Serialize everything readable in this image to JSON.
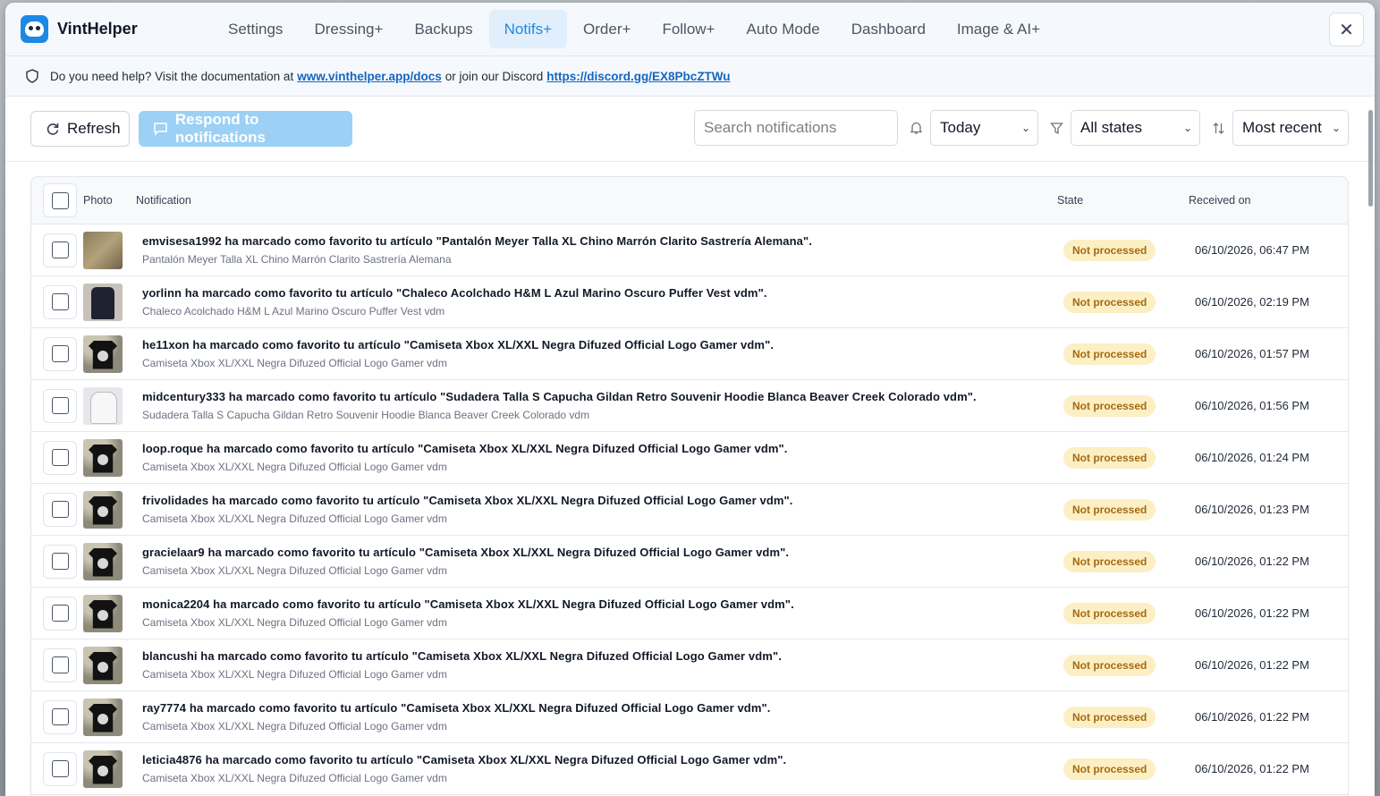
{
  "app": {
    "name": "VintHelper"
  },
  "nav": {
    "items": [
      {
        "label": "Settings",
        "active": false
      },
      {
        "label": "Dressing+",
        "active": false
      },
      {
        "label": "Backups",
        "active": false
      },
      {
        "label": "Notifs+",
        "active": true
      },
      {
        "label": "Order+",
        "active": false
      },
      {
        "label": "Follow+",
        "active": false
      },
      {
        "label": "Auto Mode",
        "active": false
      },
      {
        "label": "Dashboard",
        "active": false
      },
      {
        "label": "Image & AI+",
        "active": false
      }
    ],
    "close_symbol": "✕"
  },
  "help": {
    "prefix": "Do you need help? Visit the documentation at",
    "docs_link": "www.vinthelper.app/docs",
    "middle": "or join our Discord",
    "discord_link": "https://discord.gg/EX8PbcZTWu"
  },
  "toolbar": {
    "refresh_label": "Refresh",
    "respond_label": "Respond to notifications",
    "search_placeholder": "Search notifications",
    "date_filter": "Today",
    "state_filter": "All states",
    "sort": "Most recent"
  },
  "table": {
    "headers": {
      "photo": "Photo",
      "notification": "Notification",
      "state": "State",
      "received": "Received on"
    },
    "rows": [
      {
        "thumb": "pants",
        "main": "emvisesa1992 ha marcado como favorito tu artículo \"Pantalón Meyer Talla XL Chino Marrón Clarito Sastrería Alemana\".",
        "sub": "Pantalón Meyer Talla XL Chino Marrón Clarito Sastrería Alemana",
        "state": "Not processed",
        "received": "06/10/2026, 06:47 PM"
      },
      {
        "thumb": "vest",
        "main": "yorlinn ha marcado como favorito tu artículo \"Chaleco Acolchado H&M L Azul Marino Oscuro Puffer Vest vdm\".",
        "sub": "Chaleco Acolchado H&M L Azul Marino Oscuro Puffer Vest vdm",
        "state": "Not processed",
        "received": "06/10/2026, 02:19 PM"
      },
      {
        "thumb": "tee",
        "main": "he11xon ha marcado como favorito tu artículo \"Camiseta Xbox XL/XXL Negra Difuzed Official Logo Gamer vdm\".",
        "sub": "Camiseta Xbox XL/XXL Negra Difuzed Official Logo Gamer vdm",
        "state": "Not processed",
        "received": "06/10/2026, 01:57 PM"
      },
      {
        "thumb": "hoodie",
        "main": "midcentury333 ha marcado como favorito tu artículo \"Sudadera Talla S Capucha Gildan Retro Souvenir Hoodie Blanca Beaver Creek Colorado vdm\".",
        "sub": "Sudadera Talla S Capucha Gildan Retro Souvenir Hoodie Blanca Beaver Creek Colorado vdm",
        "state": "Not processed",
        "received": "06/10/2026, 01:56 PM"
      },
      {
        "thumb": "tee",
        "main": "loop.roque ha marcado como favorito tu artículo \"Camiseta Xbox XL/XXL Negra Difuzed Official Logo Gamer vdm\".",
        "sub": "Camiseta Xbox XL/XXL Negra Difuzed Official Logo Gamer vdm",
        "state": "Not processed",
        "received": "06/10/2026, 01:24 PM"
      },
      {
        "thumb": "tee",
        "main": "frivolidades ha marcado como favorito tu artículo \"Camiseta Xbox XL/XXL Negra Difuzed Official Logo Gamer vdm\".",
        "sub": "Camiseta Xbox XL/XXL Negra Difuzed Official Logo Gamer vdm",
        "state": "Not processed",
        "received": "06/10/2026, 01:23 PM"
      },
      {
        "thumb": "tee",
        "main": "gracielaar9 ha marcado como favorito tu artículo \"Camiseta Xbox XL/XXL Negra Difuzed Official Logo Gamer vdm\".",
        "sub": "Camiseta Xbox XL/XXL Negra Difuzed Official Logo Gamer vdm",
        "state": "Not processed",
        "received": "06/10/2026, 01:22 PM"
      },
      {
        "thumb": "tee",
        "main": "monica2204 ha marcado como favorito tu artículo \"Camiseta Xbox XL/XXL Negra Difuzed Official Logo Gamer vdm\".",
        "sub": "Camiseta Xbox XL/XXL Negra Difuzed Official Logo Gamer vdm",
        "state": "Not processed",
        "received": "06/10/2026, 01:22 PM"
      },
      {
        "thumb": "tee",
        "main": "blancushi ha marcado como favorito tu artículo \"Camiseta Xbox XL/XXL Negra Difuzed Official Logo Gamer vdm\".",
        "sub": "Camiseta Xbox XL/XXL Negra Difuzed Official Logo Gamer vdm",
        "state": "Not processed",
        "received": "06/10/2026, 01:22 PM"
      },
      {
        "thumb": "tee",
        "main": "ray7774 ha marcado como favorito tu artículo \"Camiseta Xbox XL/XXL Negra Difuzed Official Logo Gamer vdm\".",
        "sub": "Camiseta Xbox XL/XXL Negra Difuzed Official Logo Gamer vdm",
        "state": "Not processed",
        "received": "06/10/2026, 01:22 PM"
      },
      {
        "thumb": "tee",
        "main": "leticia4876 ha marcado como favorito tu artículo \"Camiseta Xbox XL/XXL Negra Difuzed Official Logo Gamer vdm\".",
        "sub": "Camiseta Xbox XL/XXL Negra Difuzed Official Logo Gamer vdm",
        "state": "Not processed",
        "received": "06/10/2026, 01:22 PM"
      }
    ]
  },
  "colors": {
    "accent": "#1d8ae6",
    "badge_bg": "#fcefc4",
    "badge_text": "#a56a12",
    "respond_btn": "#9cd0f4"
  }
}
